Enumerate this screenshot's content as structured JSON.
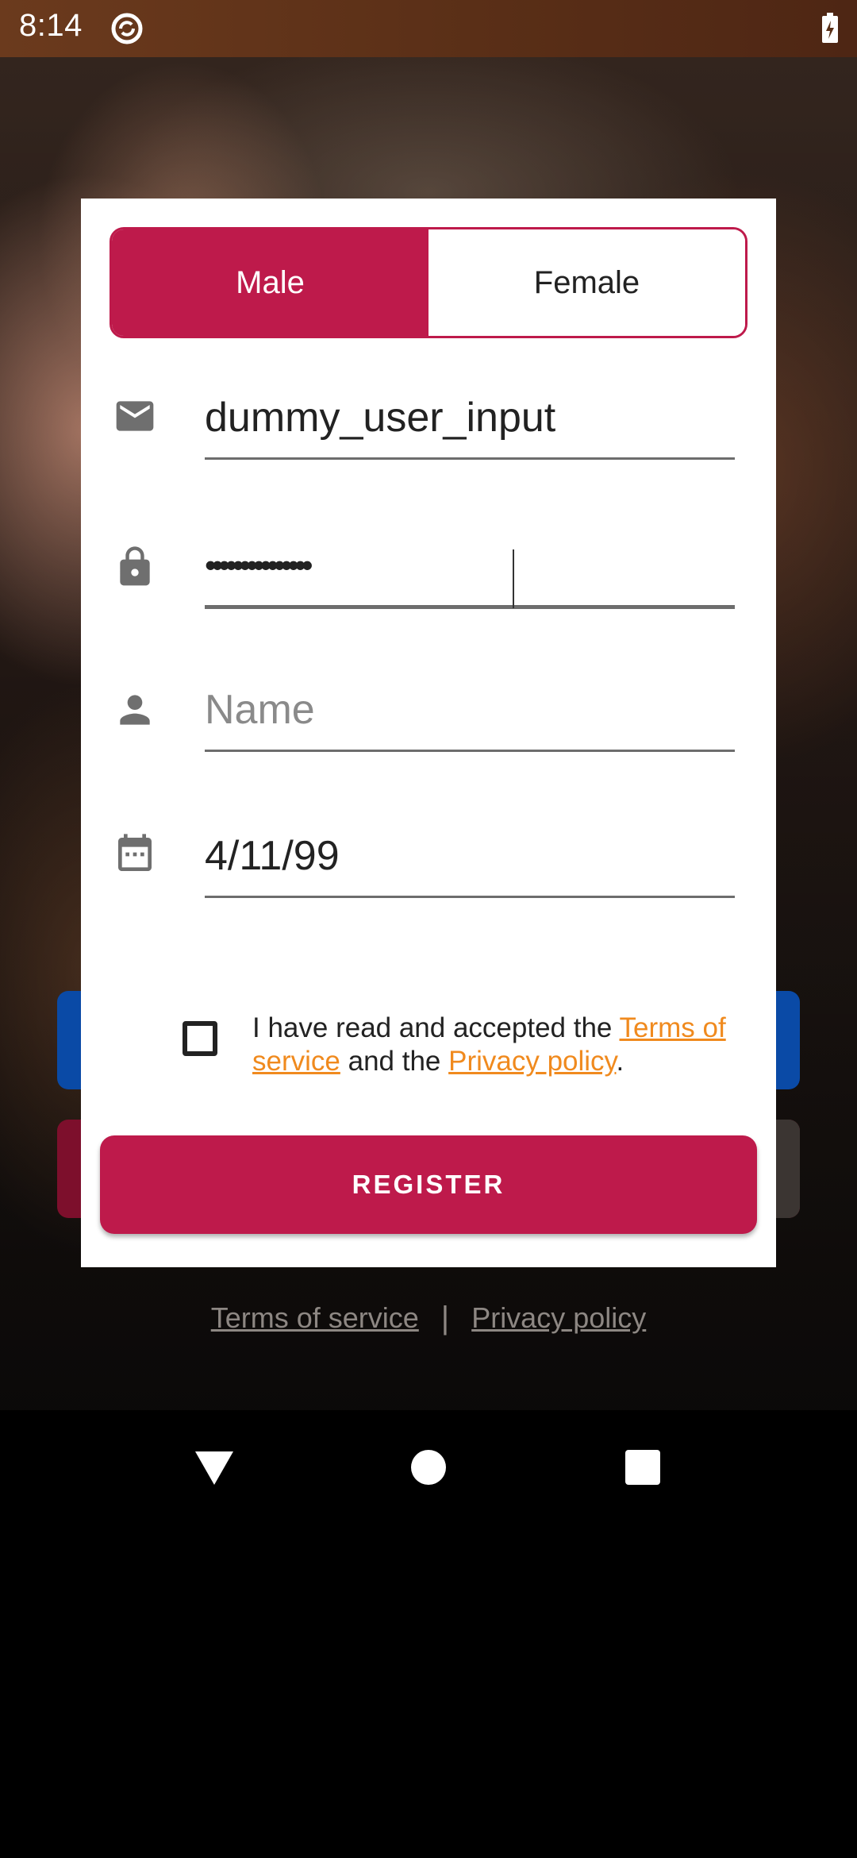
{
  "status_bar": {
    "time": "8:14",
    "app_icon": "sync-circle-icon",
    "battery_icon": "battery-charging-icon"
  },
  "gender": {
    "options": [
      "Male",
      "Female"
    ],
    "selected": "Male"
  },
  "fields": {
    "email": {
      "icon": "email-icon",
      "value": "dummy_user_input"
    },
    "password": {
      "icon": "lock-icon",
      "masked_value": "•••••••••••••••"
    },
    "name": {
      "icon": "person-icon",
      "placeholder": "Name",
      "value": ""
    },
    "birthdate": {
      "icon": "calendar-icon",
      "value": "4/11/99"
    }
  },
  "terms": {
    "checked": false,
    "prefix": "I have read and accepted the ",
    "terms_link": "Terms of service",
    "middle": " and the ",
    "privacy_link": "Privacy policy",
    "suffix": "."
  },
  "register_label": "REGISTER",
  "footer": {
    "terms_link": "Terms of service",
    "separator": "|",
    "privacy_link": "Privacy policy"
  },
  "colors": {
    "accent": "#be1a4b",
    "link": "#f08a1e",
    "underline": "#6d6d6d"
  },
  "nav_bar": {
    "back_icon": "back-triangle-icon",
    "home_icon": "home-circle-icon",
    "recents_icon": "recents-square-icon"
  }
}
